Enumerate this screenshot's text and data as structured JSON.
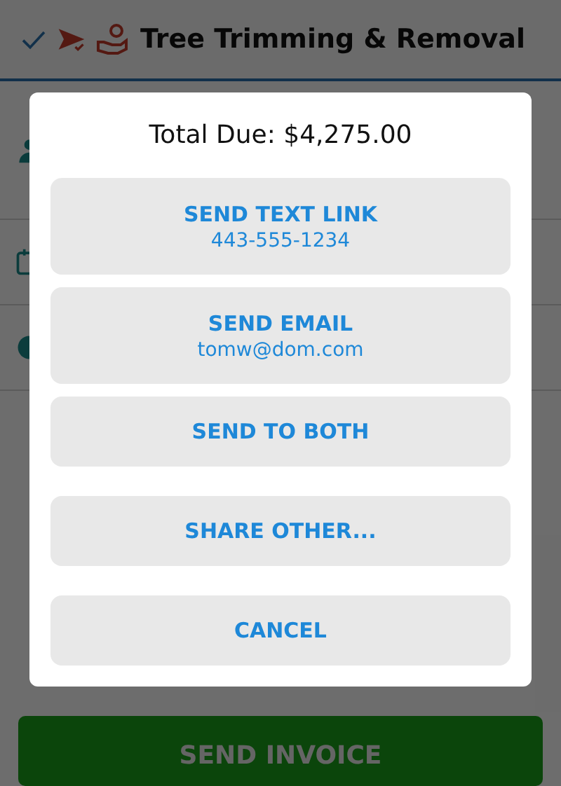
{
  "header": {
    "title": "Tree Trimming & Removal"
  },
  "dialog": {
    "total": "Total Due: $4,275.00",
    "send_options": [
      {
        "label": "SEND TEXT LINK",
        "detail": "443-555-1234"
      },
      {
        "label": "SEND EMAIL",
        "detail": "tomw@dom.com"
      },
      {
        "label": "SEND TO BOTH"
      }
    ],
    "other_options": [
      {
        "label": "SHARE OTHER..."
      },
      {
        "label": "CANCEL"
      }
    ]
  },
  "primary_button": {
    "label": "SEND INVOICE"
  }
}
